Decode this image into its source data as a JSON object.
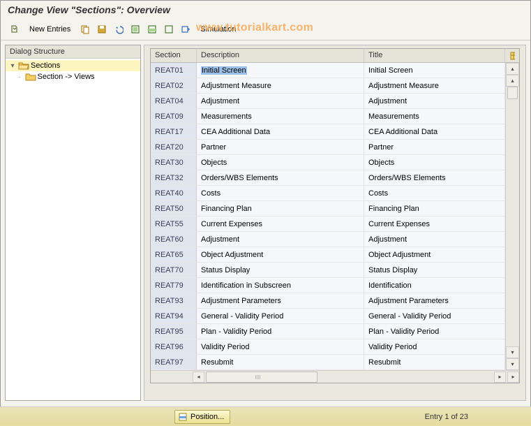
{
  "title": "Change View \"Sections\": Overview",
  "watermark": "www.tutorialkart.com",
  "toolbar": {
    "new_entries": "New Entries",
    "simulation": "Simulation"
  },
  "tree": {
    "header": "Dialog Structure",
    "root": "Sections",
    "child": "Section -> Views"
  },
  "table": {
    "headers": {
      "section": "Section",
      "description": "Description",
      "title": "Title"
    },
    "rows": [
      {
        "section": "REAT01",
        "description": "Initial Screen",
        "title": "Initial Screen",
        "selected": true
      },
      {
        "section": "REAT02",
        "description": "Adjustment Measure",
        "title": "Adjustment Measure"
      },
      {
        "section": "REAT04",
        "description": "Adjustment",
        "title": "Adjustment"
      },
      {
        "section": "REAT09",
        "description": "Measurements",
        "title": "Measurements"
      },
      {
        "section": "REAT17",
        "description": "CEA Additional Data",
        "title": "CEA Additional Data"
      },
      {
        "section": "REAT20",
        "description": "Partner",
        "title": "Partner"
      },
      {
        "section": "REAT30",
        "description": "Objects",
        "title": "Objects"
      },
      {
        "section": "REAT32",
        "description": "Orders/WBS Elements",
        "title": "Orders/WBS Elements"
      },
      {
        "section": "REAT40",
        "description": "Costs",
        "title": "Costs"
      },
      {
        "section": "REAT50",
        "description": "Financing Plan",
        "title": "Financing Plan"
      },
      {
        "section": "REAT55",
        "description": "Current Expenses",
        "title": "Current Expenses"
      },
      {
        "section": "REAT60",
        "description": "Adjustment",
        "title": "Adjustment"
      },
      {
        "section": "REAT65",
        "description": "Object Adjustment",
        "title": "Object Adjustment"
      },
      {
        "section": "REAT70",
        "description": "Status Display",
        "title": "Status Display"
      },
      {
        "section": "REAT79",
        "description": "Identification in Subscreen",
        "title": "Identification"
      },
      {
        "section": "REAT93",
        "description": "Adjustment Parameters",
        "title": "Adjustment Parameters"
      },
      {
        "section": "REAT94",
        "description": "General - Validity Period",
        "title": "General - Validity Period"
      },
      {
        "section": "REAT95",
        "description": "Plan - Validity Period",
        "title": "Plan - Validity Period"
      },
      {
        "section": "REAT96",
        "description": "Validity Period",
        "title": "Validity Period"
      },
      {
        "section": "REAT97",
        "description": "Resubmit",
        "title": "Resubmit"
      }
    ]
  },
  "footer": {
    "position": "Position...",
    "entry_info": "Entry 1 of 23"
  }
}
